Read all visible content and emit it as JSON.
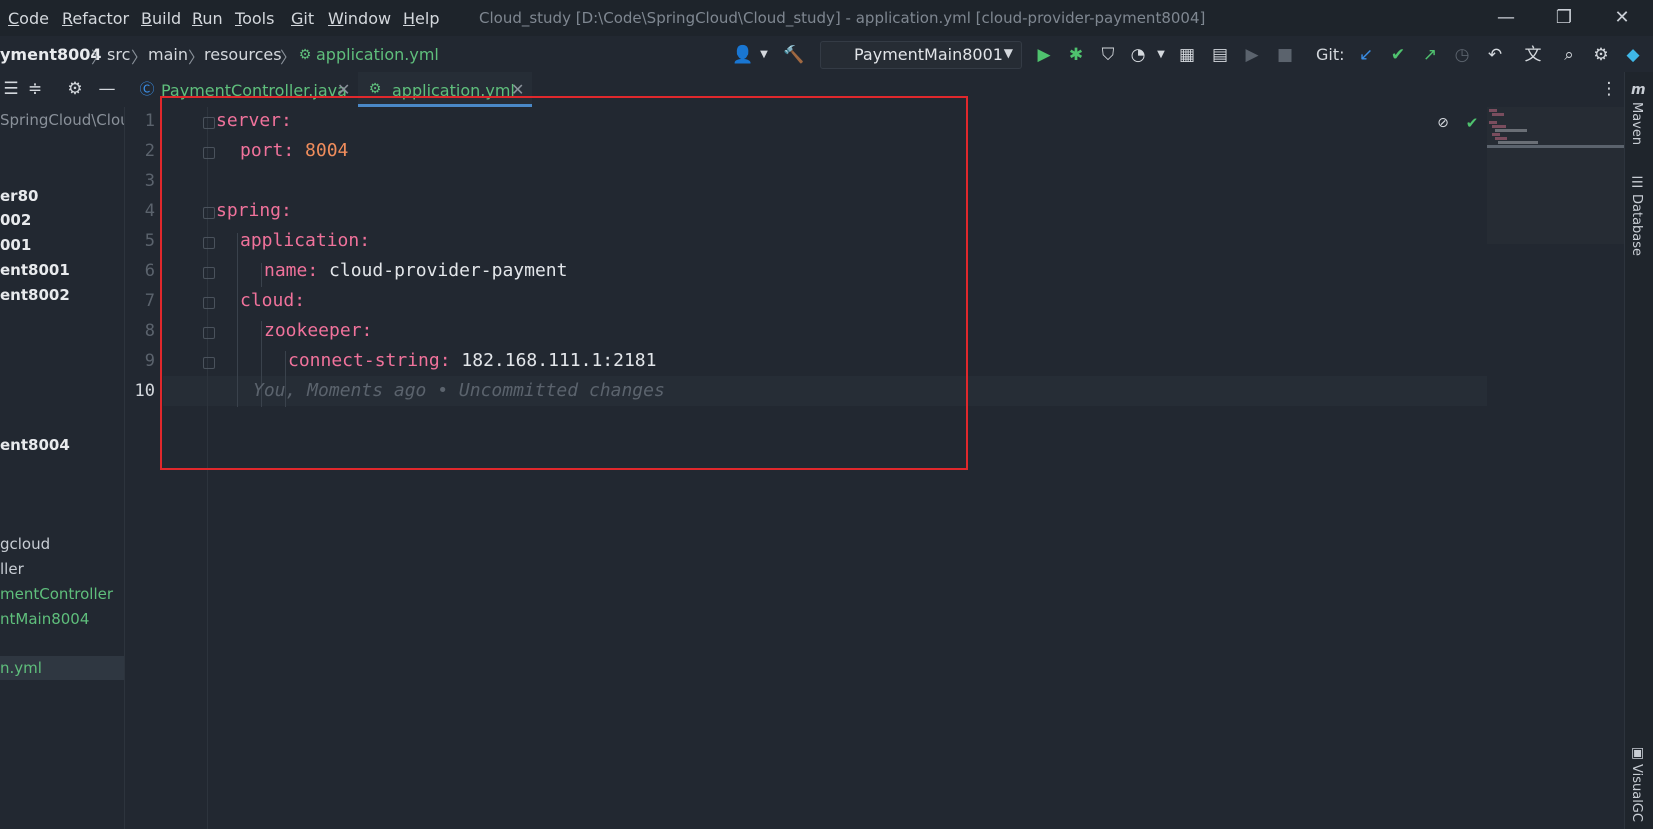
{
  "menu": {
    "items": [
      {
        "label": "Code",
        "mnemonic": "C",
        "rest": "ode"
      },
      {
        "label": "Refactor",
        "mnemonic": "R",
        "rest": "efactor"
      },
      {
        "label": "Build",
        "mnemonic": "B",
        "rest": "uild"
      },
      {
        "label": "Run",
        "mnemonic": "R",
        "rest": "un"
      },
      {
        "label": "Tools",
        "mnemonic": "T",
        "rest": "ools"
      },
      {
        "label": "Git",
        "mnemonic": "G",
        "rest": "it"
      },
      {
        "label": "Window",
        "mnemonic": "W",
        "rest": "indow"
      },
      {
        "label": "Help",
        "mnemonic": "H",
        "rest": "elp"
      }
    ],
    "window_title": "Cloud_study [D:\\Code\\SpringCloud\\Cloud_study] - application.yml [cloud-provider-payment8004]"
  },
  "window_controls": {
    "minimize": "—",
    "restore": "❐",
    "close": "✕"
  },
  "breadcrumb": [
    "yment8004",
    "src",
    "main",
    "resources",
    "application.yml"
  ],
  "breadcrumb_separator": "〉",
  "run_config": {
    "label": "PaymentMain8001",
    "arrow": "▼"
  },
  "toolbar": {
    "git_label": "Git:"
  },
  "tabs": [
    {
      "label": "PaymentController.java",
      "close": "✕"
    },
    {
      "label": "application.yml",
      "close": "✕"
    }
  ],
  "project_tree": {
    "path_fragment": "SpringCloud\\Clou",
    "items": [
      {
        "label": "er80",
        "style": "bold"
      },
      {
        "label": "002",
        "style": "bold"
      },
      {
        "label": "001",
        "style": "bold"
      },
      {
        "label": "ent8001",
        "style": "bold"
      },
      {
        "label": "ent8002",
        "style": "bold"
      },
      {
        "label": "ent8004",
        "style": "bold"
      },
      {
        "label": "gcloud",
        "style": "plain"
      },
      {
        "label": "ller",
        "style": "plain"
      },
      {
        "label": "mentController",
        "style": "green"
      },
      {
        "label": "ntMain8004",
        "style": "green"
      },
      {
        "label": "n.yml",
        "style": "green"
      }
    ]
  },
  "editor": {
    "line_numbers": [
      "1",
      "2",
      "3",
      "4",
      "5",
      "6",
      "7",
      "8",
      "9",
      "10"
    ],
    "code": {
      "l1_key": "server",
      "l1_colon": ":",
      "l2_key": "port",
      "l2_colon": ": ",
      "l2_value": "8004",
      "l4_key": "spring",
      "l4_colon": ":",
      "l5_key": "application",
      "l5_colon": ":",
      "l6_key": "name",
      "l6_colon": ": ",
      "l6_value": "cloud-provider-payment",
      "l7_key": "cloud",
      "l7_colon": ":",
      "l8_key": "zookeeper",
      "l8_colon": ":",
      "l9_key": "connect-string",
      "l9_colon": ": ",
      "l9_value": "182.168.111.1:2181"
    },
    "blame_hint": "You, Moments ago • Uncommitted changes"
  },
  "right_strip": {
    "maven": "Maven",
    "database": "Database",
    "visualgc": "VisualGC"
  },
  "colors": {
    "background": "#222831",
    "key": "#f0729b",
    "number": "#f08d5c",
    "accent_green": "#5fbf7c",
    "highlight_box": "#e0282c"
  }
}
